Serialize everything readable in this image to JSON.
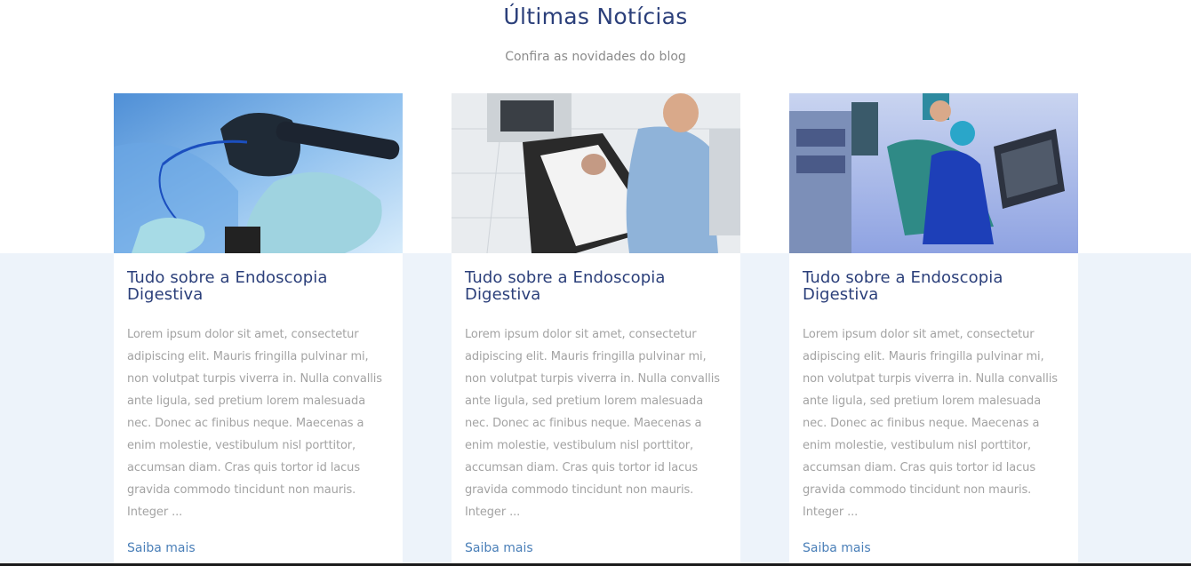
{
  "section": {
    "title": "Últimas Notícias",
    "subtitle": "Confira as novidades do blog"
  },
  "posts": [
    {
      "title": "Tudo sobre a Endoscopia Digestiva",
      "excerpt": "Lorem ipsum dolor sit amet, consectetur adipiscing elit. Mauris fringilla pulvinar mi, non volutpat turpis viverra in. Nulla convallis ante ligula, sed pretium lorem malesuada nec. Donec ac finibus neque. Maecenas a enim molestie, vestibulum nisl porttitor, accumsan diam. Cras quis tortor id lacus gravida commodo tincidunt non mauris. Integer ...",
      "link": "Saiba mais"
    },
    {
      "title": "Tudo sobre a Endoscopia Digestiva",
      "excerpt": "Lorem ipsum dolor sit amet, consectetur adipiscing elit. Mauris fringilla pulvinar mi, non volutpat turpis viverra in. Nulla convallis ante ligula, sed pretium lorem malesuada nec. Donec ac finibus neque. Maecenas a enim molestie, vestibulum nisl porttitor, accumsan diam. Cras quis tortor id lacus gravida commodo tincidunt non mauris. Integer ...",
      "link": "Saiba mais"
    },
    {
      "title": "Tudo sobre a Endoscopia Digestiva",
      "excerpt": "Lorem ipsum dolor sit amet, consectetur adipiscing elit. Mauris fringilla pulvinar mi, non volutpat turpis viverra in. Nulla convallis ante ligula, sed pretium lorem malesuada nec. Donec ac finibus neque. Maecenas a enim molestie, vestibulum nisl porttitor, accumsan diam. Cras quis tortor id lacus gravida commodo tincidunt non mauris. Integer ...",
      "link": "Saiba mais"
    }
  ],
  "colors": {
    "title": "#2b3f7a",
    "subtitle": "#8b8b8b",
    "text": "#a3a3a3",
    "link": "#4a7fb8",
    "band": "#edf3fa"
  }
}
